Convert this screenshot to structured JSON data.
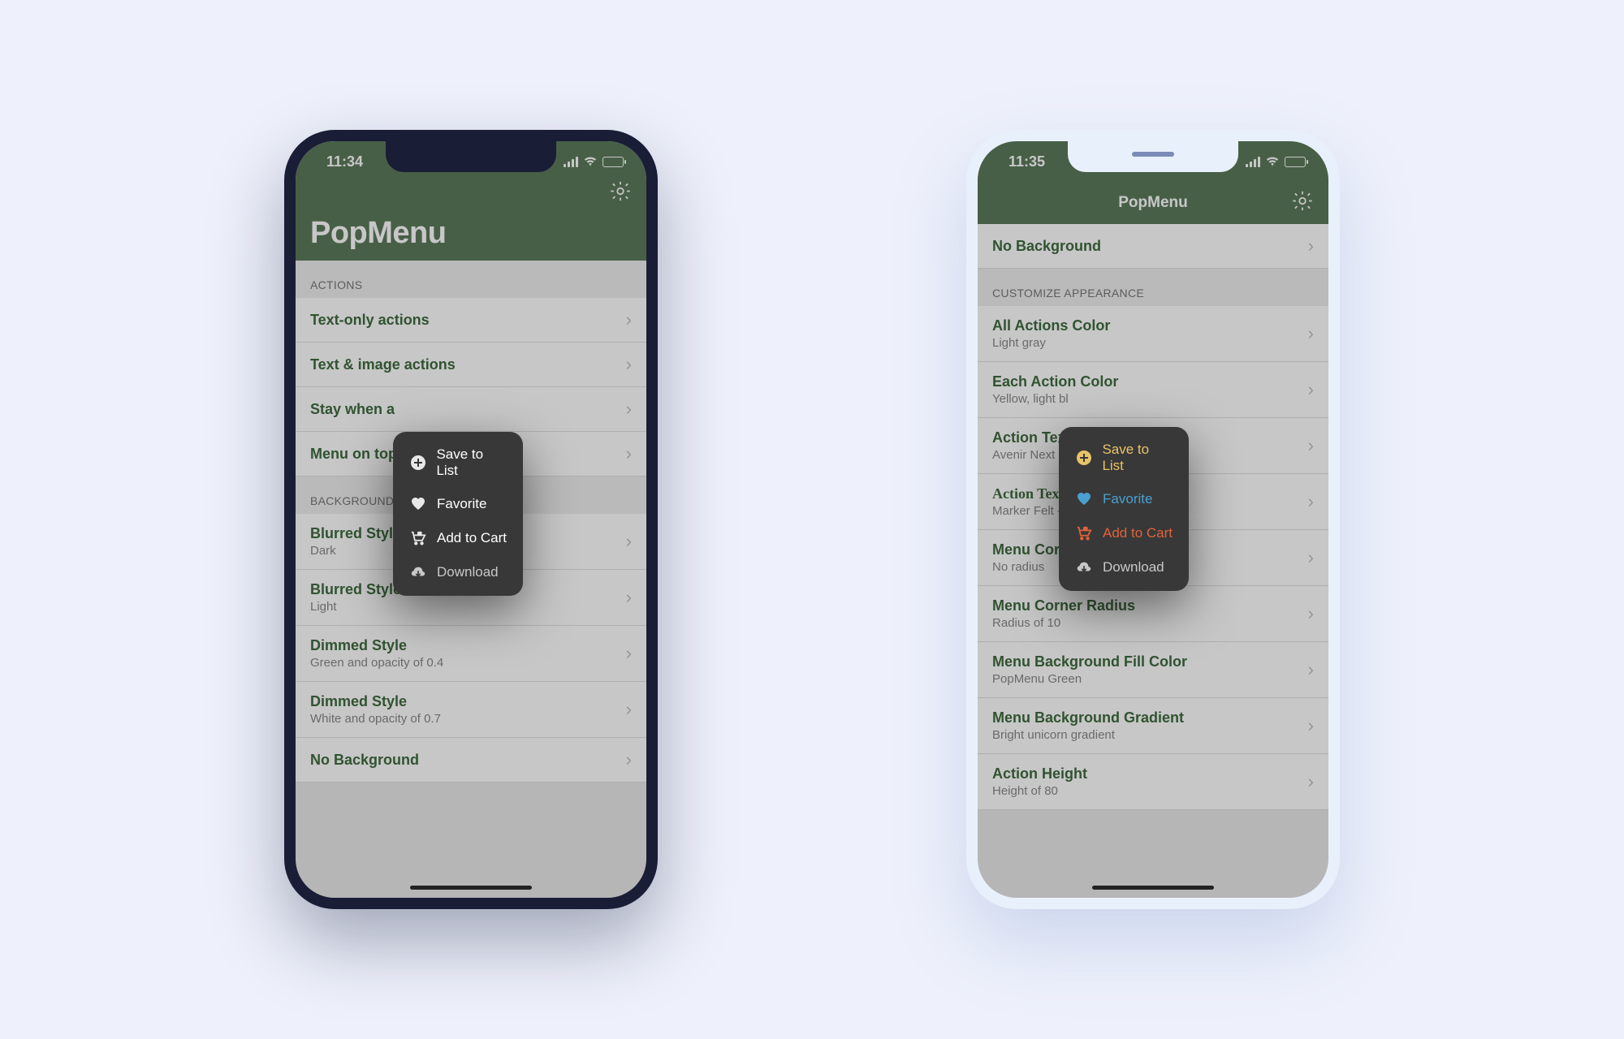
{
  "phone1": {
    "time": "11:34",
    "title": "PopMenu",
    "sections": [
      {
        "header": "ACTIONS",
        "rows": [
          {
            "title": "Text-only actions"
          },
          {
            "title": "Text & image actions"
          },
          {
            "title": "Stay when a"
          },
          {
            "title": "Menu on top"
          }
        ]
      },
      {
        "header": "BACKGROUND",
        "rows": [
          {
            "title": "Blurred Style",
            "sub": "Dark"
          },
          {
            "title": "Blurred Style",
            "sub": "Light"
          },
          {
            "title": "Dimmed Style",
            "sub": "Green and opacity of 0.4"
          },
          {
            "title": "Dimmed Style",
            "sub": "White and opacity of 0.7"
          },
          {
            "title": "No Background"
          }
        ]
      }
    ],
    "popup": [
      {
        "icon": "plus-circle",
        "label": "Save to List",
        "color": "#ffffff"
      },
      {
        "icon": "heart",
        "label": "Favorite",
        "color": "#ffffff"
      },
      {
        "icon": "cart",
        "label": "Add to Cart",
        "color": "#ffffff"
      },
      {
        "icon": "download",
        "label": "Download",
        "color": "#c8c8c8"
      }
    ]
  },
  "phone2": {
    "time": "11:35",
    "title": "PopMenu",
    "top_row": {
      "title": "No Background"
    },
    "section_header": "CUSTOMIZE APPEARANCE",
    "rows": [
      {
        "title": "All Actions Color",
        "sub": "Light gray"
      },
      {
        "title": "Each Action Color",
        "sub": "Yellow, light bl"
      },
      {
        "title": "Action Text F",
        "sub": "Avenir Next - 1"
      },
      {
        "title": "Action Text F",
        "sub": "Marker Felt - 13",
        "marker": true
      },
      {
        "title": "Menu Corner Radius",
        "sub": "No radius"
      },
      {
        "title": "Menu Corner Radius",
        "sub": "Radius of 10"
      },
      {
        "title": "Menu Background Fill Color",
        "sub": "PopMenu Green"
      },
      {
        "title": "Menu Background Gradient",
        "sub": "Bright unicorn gradient"
      },
      {
        "title": "Action Height",
        "sub": "Height of 80"
      }
    ],
    "popup": [
      {
        "icon": "plus-circle",
        "label": "Save to List",
        "color": "#e8c468"
      },
      {
        "icon": "heart",
        "label": "Favorite",
        "color": "#4aa0d0"
      },
      {
        "icon": "cart",
        "label": "Add to Cart",
        "color": "#e0623a"
      },
      {
        "icon": "download",
        "label": "Download",
        "color": "#c8c8c8"
      }
    ]
  }
}
